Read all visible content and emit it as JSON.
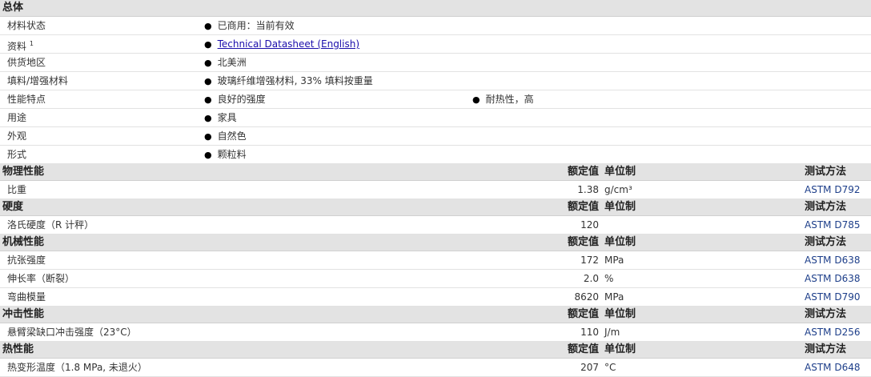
{
  "general": {
    "title": "总体",
    "rows": [
      {
        "label": "材料状态",
        "items": [
          "已商用：当前有效"
        ]
      },
      {
        "label": "资料",
        "sup": "1",
        "link": "Technical Datasheet (English)"
      },
      {
        "label": "供货地区",
        "items": [
          "北美洲"
        ]
      },
      {
        "label": "填料/增强材料",
        "items": [
          "玻璃纤维增强材料, 33% 填料按重量"
        ]
      },
      {
        "label": "性能特点",
        "items": [
          "良好的强度",
          "耐热性，高"
        ]
      },
      {
        "label": "用途",
        "items": [
          "家具"
        ]
      },
      {
        "label": "外观",
        "items": [
          "自然色"
        ]
      },
      {
        "label": "形式",
        "items": [
          "颗粒料"
        ]
      }
    ]
  },
  "column_headers": {
    "value": "额定值",
    "unit": "单位制",
    "method": "测试方法"
  },
  "sections": [
    {
      "title": "物理性能",
      "rows": [
        {
          "label": "比重",
          "value": "1.38",
          "unit": "g/cm³",
          "method": "ASTM D792"
        }
      ]
    },
    {
      "title": "硬度",
      "rows": [
        {
          "label": "洛氏硬度（R 计秤）",
          "value": "120",
          "unit": "",
          "method": "ASTM D785"
        }
      ]
    },
    {
      "title": "机械性能",
      "rows": [
        {
          "label": "抗张强度",
          "value": "172",
          "unit": "MPa",
          "method": "ASTM D638"
        },
        {
          "label": "伸长率（断裂）",
          "value": "2.0",
          "unit": "%",
          "method": "ASTM D638"
        },
        {
          "label": "弯曲模量",
          "value": "8620",
          "unit": "MPa",
          "method": "ASTM D790"
        }
      ]
    },
    {
      "title": "冲击性能",
      "rows": [
        {
          "label": "悬臂梁缺口冲击强度（23°C）",
          "value": "110",
          "unit": "J/m",
          "method": "ASTM D256"
        }
      ]
    },
    {
      "title": "热性能",
      "rows": [
        {
          "label": "热变形温度（1.8 MPa, 未退火）",
          "value": "207",
          "unit": "°C",
          "method": "ASTM D648"
        }
      ]
    }
  ]
}
